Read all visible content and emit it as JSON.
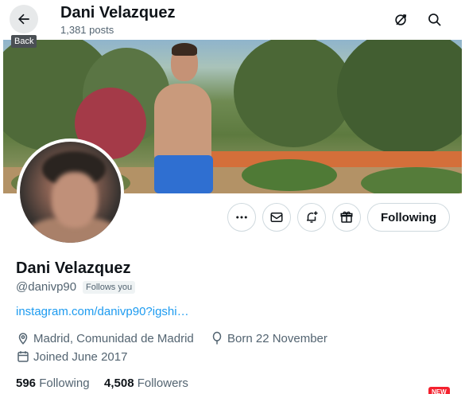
{
  "header": {
    "title": "Dani Velazquez",
    "posts": "1,381 posts",
    "back_tooltip": "Back"
  },
  "profile": {
    "name": "Dani Velazquez",
    "handle": "@danivp90",
    "follows_you": "Follows you",
    "link": "instagram.com/danivp90?igshi…",
    "location": "Madrid, Comunidad de Madrid",
    "born": "Born 22 November",
    "joined": "Joined June 2017",
    "following_count": "596",
    "following_label": "Following",
    "followers_count": "4,508",
    "followers_label": "Followers"
  },
  "actions": {
    "following_button": "Following"
  },
  "badges": {
    "new": "NEW"
  },
  "colors": {
    "link": "#1d9bf0",
    "secondary_text": "#536471",
    "primary_text": "#0f1419",
    "new_badge": "#f4212e"
  },
  "icons": [
    "back-arrow-icon",
    "feed-toggle-icon",
    "search-icon",
    "more-icon",
    "mail-icon",
    "notification-add-icon",
    "gift-icon",
    "location-icon",
    "balloon-icon",
    "calendar-icon"
  ]
}
